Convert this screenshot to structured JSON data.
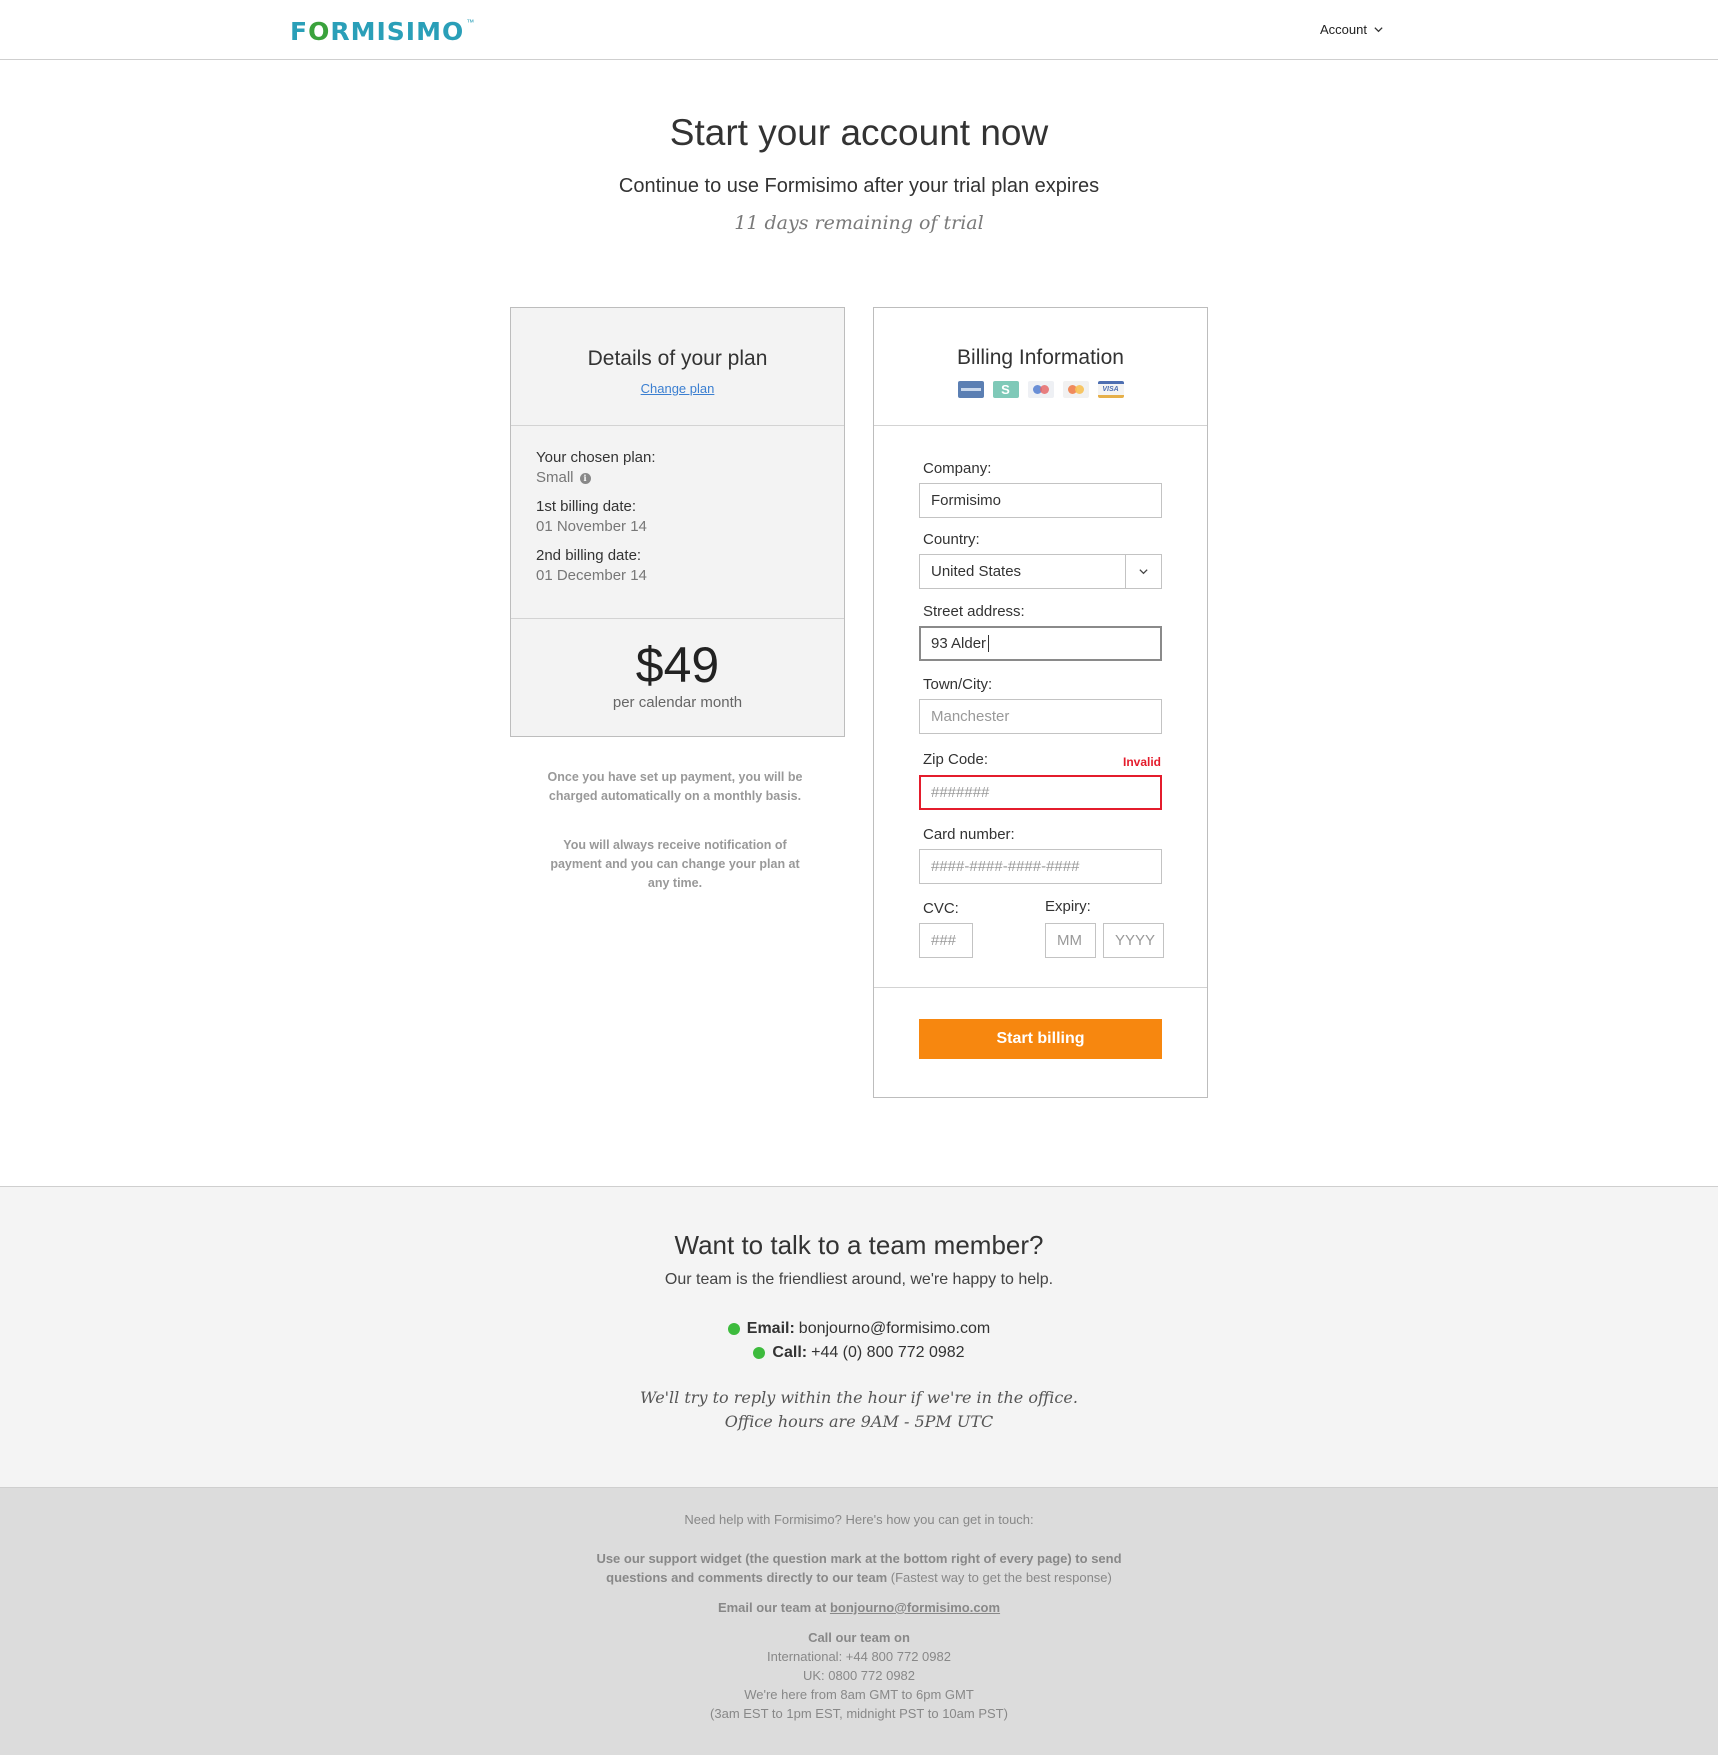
{
  "header": {
    "logo_text_before": "F",
    "logo_text_o": "O",
    "logo_text_after": "RMISIMO",
    "logo_tm": "™",
    "account_label": "Account"
  },
  "hero": {
    "title": "Start your account now",
    "subtitle": "Continue to use Formisimo after your trial plan expires",
    "trial": "11 days remaining of trial"
  },
  "plan": {
    "title": "Details of your plan",
    "change_link": "Change plan",
    "chosen_label": "Your chosen plan:",
    "chosen_value": "Small",
    "first_billing_label": "1st billing date:",
    "first_billing_value": "01 November 14",
    "second_billing_label": "2nd billing date:",
    "second_billing_value": "01 December 14",
    "price": "$49",
    "period": "per calendar month",
    "note1": "Once you have set up payment, you will be charged automatically on a monthly basis.",
    "note2": "You will always receive notification of payment and you can change your plan at any time."
  },
  "billing": {
    "title": "Billing Information",
    "card_icons": [
      "amex-card-icon",
      "switch-card-icon",
      "maestro-card-icon",
      "mastercard-icon",
      "visa-card-icon"
    ],
    "company_label": "Company:",
    "company_value": "Formisimo",
    "country_label": "Country:",
    "country_value": "United States",
    "street_label": "Street address:",
    "street_value": "93 Alder",
    "town_label": "Town/City:",
    "town_placeholder": "Manchester",
    "zip_label": "Zip Code:",
    "zip_error": "Invalid",
    "zip_placeholder": "#######",
    "card_label": "Card number:",
    "card_placeholder": "####-####-####-####",
    "cvc_label": "CVC:",
    "cvc_placeholder": "###",
    "expiry_label": "Expiry:",
    "expiry_month_placeholder": "MM",
    "expiry_year_placeholder": "YYYY",
    "submit_label": "Start billing",
    "accent_color": "#f7870f",
    "error_color": "#e41c2c"
  },
  "contact": {
    "title": "Want to talk to a team member?",
    "subtitle": "Our team is the friendliest around, we're happy to help.",
    "email_label": "Email:",
    "email_value": "bonjourno@formisimo.com",
    "call_label": "Call:",
    "call_value": "+44 (0) 800 772 0982",
    "reply_note": "We'll try to reply within the hour if we're in the office.",
    "hours_note": "Office hours are 9AM - 5PM UTC"
  },
  "footer": {
    "intro": "Need help with Formisimo? Here's how you can get in touch:",
    "widget_bold_1": "Use our support widget (the question mark at the bottom right of every page) to send",
    "widget_bold_2": "questions and comments directly to our team",
    "widget_note": "(Fastest way to get the best response)",
    "email_prefix": "Email our team at",
    "email_link": "bonjourno@formisimo.com",
    "call_heading": "Call our team on",
    "international": "International: +44 800 772 0982",
    "uk": "UK: 0800 772 0982",
    "hours": "We're here from 8am GMT to 6pm GMT",
    "hours_other": "(3am EST to 1pm EST, midnight PST to 10am PST)"
  }
}
